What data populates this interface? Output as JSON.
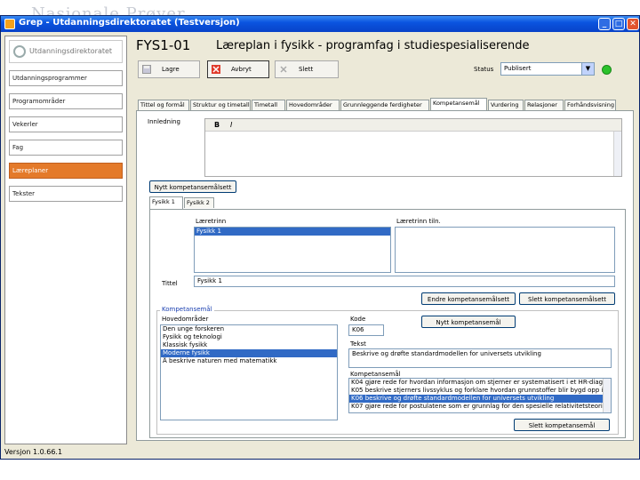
{
  "window": {
    "title": "Grep - Utdanningsdirektoratet (Testversjon)"
  },
  "background": {
    "logo_text": "Nasjonale Prøver"
  },
  "nav": {
    "logo_text": "Utdanningsdirektoratet",
    "items": [
      {
        "label": "Utdanningsprogrammer",
        "active": false
      },
      {
        "label": "Programområder",
        "active": false
      },
      {
        "label": "Vekerler",
        "active": false
      },
      {
        "label": "Fag",
        "active": false
      },
      {
        "label": "Læreplaner",
        "active": true
      },
      {
        "label": "Tekster",
        "active": false
      }
    ]
  },
  "header": {
    "code": "FYS1-01",
    "title": "Læreplan i fysikk - programfag i studiespesialiserende"
  },
  "toolbar": {
    "save_label": "Lagre",
    "cancel_label": "Avbryt",
    "delete_label": "Slett",
    "status_label": "Status",
    "status_value": "Publisert",
    "status_color": "#2bc22b"
  },
  "tabs": [
    {
      "label": "Tittel og formål",
      "active": false
    },
    {
      "label": "Struktur og timetall",
      "active": false
    },
    {
      "label": "Timetall",
      "active": false
    },
    {
      "label": "Hovedområder",
      "active": false
    },
    {
      "label": "Grunnleggende ferdigheter",
      "active": false
    },
    {
      "label": "Kompetansemål",
      "active": true
    },
    {
      "label": "Vurdering",
      "active": false
    },
    {
      "label": "Relasjoner",
      "active": false
    },
    {
      "label": "Forhåndsvisning",
      "active": false
    }
  ],
  "panel": {
    "innledning_label": "Innledning",
    "bold_label": "B",
    "italic_label": "I",
    "new_set_button": "Nytt kompetansemålsett",
    "subtabs": [
      "Fysikk 1",
      "Fysikk 2"
    ],
    "laertrinn_label": "Læretrinn",
    "laertrinn_items": [
      "Fysikk 1"
    ],
    "laertrinn_right_label": "Læretrinn tiln.",
    "tittel_label": "Tittel",
    "tittel_value": "Fysikk 1",
    "endre_button": "Endre kompetansemålsett",
    "slett_set_button": "Slett kompetansemålsett",
    "kompetansemal_group": "Kompetansemål",
    "hovedomrader_label": "Hovedområder",
    "hovedomrader_items": [
      {
        "label": "Den unge forskeren",
        "selected": false
      },
      {
        "label": "Fysikk og teknologi",
        "selected": false
      },
      {
        "label": "Klassisk fysikk",
        "selected": false
      },
      {
        "label": "Moderne fysikk",
        "selected": true
      },
      {
        "label": "Å beskrive naturen med matematikk",
        "selected": false
      }
    ],
    "kode_label": "Kode",
    "kode_value": "K06",
    "nytt_mal_button": "Nytt kompetansemål",
    "tekst_label": "Tekst",
    "tekst_value": "Beskrive og drøfte standardmodellen for universets utvikling",
    "kompetansemal_list_label": "Kompetansemål",
    "kompetansemal_items": [
      {
        "label": "K04 gjøre rede for hvordan informasjon om stjerner er systematisert i et HR-diagram",
        "selected": false
      },
      {
        "label": "K05 beskrive stjerners livssyklus og forklare hvordan grunnstoffer blir bygd opp i",
        "selected": false
      },
      {
        "label": "K06 beskrive og drøfte standardmodellen for universets utvikling",
        "selected": true
      },
      {
        "label": "K07 gjøre rede for postulatene som er grunnlag for den spesielle relativitetsteorien",
        "selected": false
      }
    ],
    "slett_mal_button": "Slett kompetansemål"
  },
  "footer": {
    "version": "Versjon 1.0.66.1"
  }
}
